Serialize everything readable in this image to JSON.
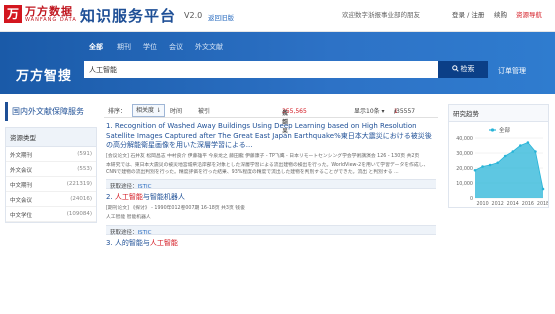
{
  "header": {
    "logo_cn": "万方数据",
    "logo_en": "WANFANG DATA",
    "platform_title": "知识服务平台",
    "version": "V2.0",
    "old_version_link": "返回旧版",
    "welcome": "欢迎数字浙报事业部的朋友",
    "login_register": "登录 / 注册",
    "cart": "续购",
    "recharge": "资源导航"
  },
  "search": {
    "scopes": [
      "全部",
      "期刊",
      "学位",
      "会议",
      "外文文献"
    ],
    "active_scope": 0,
    "brand": "万方智搜",
    "query": "人工智能",
    "button_label": "检索",
    "order_link": "订单管理"
  },
  "sidebar": {
    "title": "国内外文献保障服务",
    "group_title": "资源类型",
    "items": [
      {
        "label": "外文期刊",
        "count": "(591)"
      },
      {
        "label": "外文会议",
        "count": "(553)"
      },
      {
        "label": "中文期刊",
        "count": "(221319)"
      },
      {
        "label": "中文会议",
        "count": "(24016)"
      },
      {
        "label": "中文学位",
        "count": "(109084)"
      }
    ]
  },
  "sortbar": {
    "sort_label": "排序：",
    "relevance": "相关度 ⇂",
    "time": "时间",
    "cited": "被引",
    "found_prefix": "找到",
    "found_count": "355,565",
    "found_suffix": "条结果",
    "per_page": "显示10条 ▾",
    "prev": "‹",
    "current_page": "1",
    "total_pages": "/35557",
    "next": "›"
  },
  "results": [
    {
      "title_pre": "1. Recognition of Washed Away Buildings Using Deep Learning based on High Resolution Satellite Images Captured after The Great East Japan Earthquake%東日本大震災における被災後の高分解能衛星画像を用いた深層学習による...",
      "title_hl": "",
      "title_post": "",
      "meta": "[会议论文]  石井友  松岡昌志  中村良介  伊藤雄平  今泉龙之  藤田龍  伊藤康子 - TP飞鹰  - 日本リモートセンシング学会学術講演会  126 - 130页  共2页",
      "abstract": "本研究では、東日本大震災の被災地宮城県沿岸部を対象とした深層学習による流出建物の検出を行った。WorldView-2を用いて学習データを作成し、CNNで建物の流出判別を行った。精度評価を行った結果、93%程度の精度で流出した建物を判別することができた。流出 と判別する ...",
      "get_label": "获取途径：",
      "get_source": "ISTIC"
    },
    {
      "title_pre": "2. ",
      "title_hl": "人工智能",
      "title_post": "与智能机器人",
      "meta": "[期刊论文]  《探讨》  - 1990年012卷007期  16-18页  共3页  钱俊",
      "abstract": "人工智能  智能机器人",
      "get_label": "获取途径：",
      "get_source": "ISTIC"
    },
    {
      "title_pre": "3. 人的智能与",
      "title_hl": "人工智能",
      "title_post": "",
      "meta": "",
      "abstract": "",
      "get_label": "",
      "get_source": ""
    }
  ],
  "trend": {
    "title": "研究趋势",
    "legend": "全部"
  },
  "chart_data": {
    "type": "area",
    "title": "",
    "series": [
      {
        "name": "全部",
        "values": [
          18500,
          21000,
          22000,
          23500,
          28000,
          31000,
          35000,
          37000,
          31000,
          6000
        ]
      }
    ],
    "x": [
      2009,
      2010,
      2011,
      2012,
      2013,
      2014,
      2015,
      2016,
      2017,
      2018
    ],
    "x_ticks": [
      "2010",
      "2012",
      "2014",
      "2016",
      "2018"
    ],
    "y_ticks": [
      "0",
      "10,000",
      "20,000",
      "30,000",
      "40,000"
    ],
    "ylim": [
      0,
      40000
    ],
    "color": "#28b4d8",
    "legend_placement": "top"
  }
}
